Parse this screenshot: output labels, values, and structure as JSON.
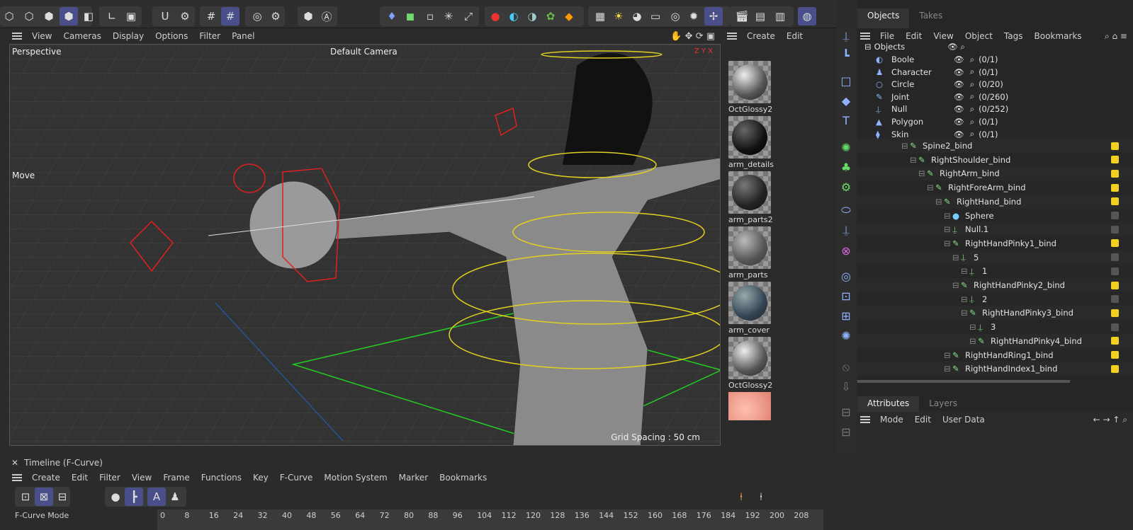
{
  "viewport_menu": [
    "View",
    "Cameras",
    "Display",
    "Options",
    "Filter",
    "Panel"
  ],
  "viewport": {
    "name": "Perspective",
    "camera": "Default Camera",
    "tool": "Move",
    "grid": "Grid Spacing : 50 cm"
  },
  "material_menu": [
    "Create",
    "Edit"
  ],
  "materials": [
    "OctGlossy2",
    "arm_details",
    "arm_parts2",
    "arm_parts",
    "arm_cover",
    "OctGlossy2"
  ],
  "obj_tabs": [
    "Objects",
    "Takes"
  ],
  "obj_menu": [
    "File",
    "Edit",
    "View",
    "Object",
    "Tags",
    "Bookmarks"
  ],
  "filter": {
    "title": "Objects",
    "rows": [
      {
        "name": "Boole",
        "count": "(0/1)"
      },
      {
        "name": "Character",
        "count": "(0/1)"
      },
      {
        "name": "Circle",
        "count": "(0/20)"
      },
      {
        "name": "Joint",
        "count": "(0/260)"
      },
      {
        "name": "Null",
        "count": "(0/252)"
      },
      {
        "name": "Polygon",
        "count": "(0/1)"
      },
      {
        "name": "Skin",
        "count": "(0/1)"
      }
    ]
  },
  "tree": [
    {
      "name": "Spine2_bind",
      "indent": 0
    },
    {
      "name": "RightShoulder_bind",
      "indent": 1
    },
    {
      "name": "RightArm_bind",
      "indent": 2
    },
    {
      "name": "RightForeArm_bind",
      "indent": 3
    },
    {
      "name": "RightHand_bind",
      "indent": 4
    },
    {
      "name": "Sphere",
      "indent": 5
    },
    {
      "name": "Null.1",
      "indent": 5
    },
    {
      "name": "RightHandPinky1_bind",
      "indent": 5
    },
    {
      "name": "5",
      "indent": 6
    },
    {
      "name": "1",
      "indent": 7
    },
    {
      "name": "RightHandPinky2_bind",
      "indent": 6
    },
    {
      "name": "2",
      "indent": 7
    },
    {
      "name": "RightHandPinky3_bind",
      "indent": 7
    },
    {
      "name": "3",
      "indent": 8
    },
    {
      "name": "RightHandPinky4_bind",
      "indent": 8
    },
    {
      "name": "RightHandRing1_bind",
      "indent": 5
    },
    {
      "name": "RightHandIndex1_bind",
      "indent": 5
    }
  ],
  "attr_tabs": [
    "Attributes",
    "Layers"
  ],
  "attr_menu": [
    "Mode",
    "Edit",
    "User Data"
  ],
  "timeline": {
    "title": "Timeline (F-Curve)",
    "menu": [
      "Create",
      "Edit",
      "Filter",
      "View",
      "Frame",
      "Functions",
      "Key",
      "F-Curve",
      "Motion System",
      "Marker",
      "Bookmarks"
    ],
    "mode": "F-Curve Mode",
    "ticks": [
      "0",
      "8",
      "16",
      "24",
      "32",
      "40",
      "48",
      "56",
      "64",
      "72",
      "80",
      "88",
      "96",
      "104",
      "112",
      "120",
      "128",
      "136",
      "144",
      "152",
      "160",
      "168",
      "176",
      "184",
      "192",
      "200",
      "208"
    ]
  }
}
